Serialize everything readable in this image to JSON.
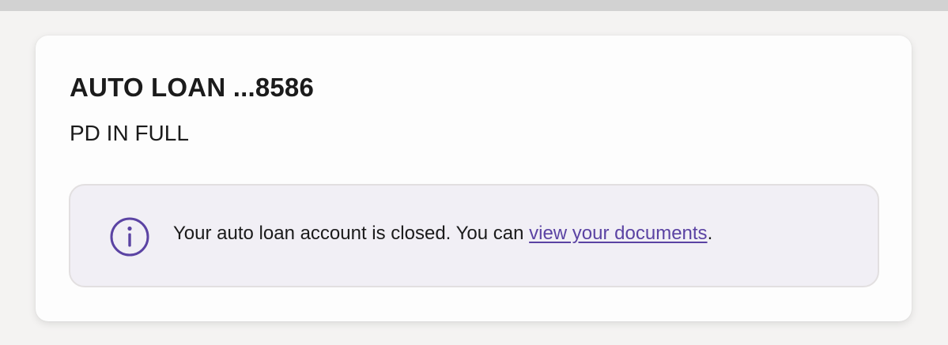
{
  "account": {
    "title": "AUTO LOAN ...8586",
    "status": "PD IN FULL"
  },
  "notice": {
    "icon": "info-icon",
    "text_before": "Your auto loan account is closed. You can ",
    "link_label": "view your documents",
    "text_after": "."
  },
  "colors": {
    "accent": "#5b43a3",
    "notice_background": "#f1eff5"
  }
}
